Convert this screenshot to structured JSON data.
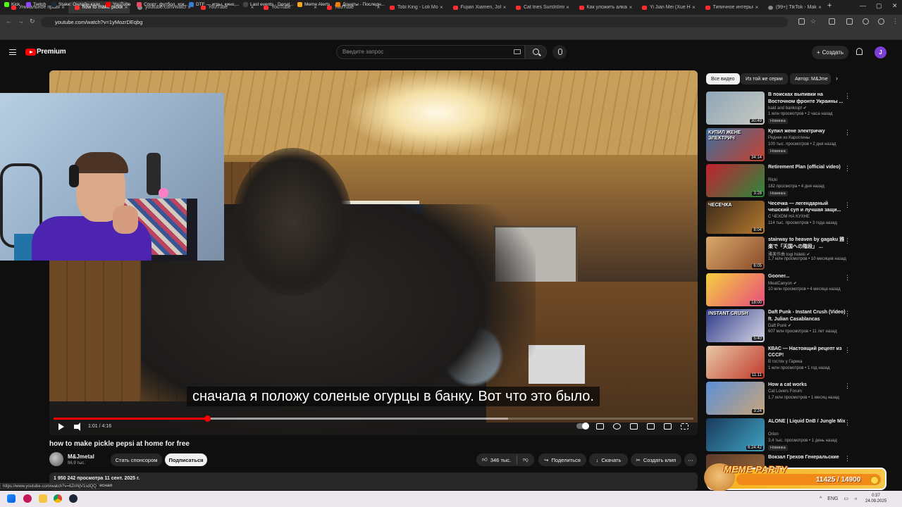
{
  "browser": {
    "tabs": [
      {
        "title": "Уникальное правил",
        "active": false,
        "favicon": "youtube-icon"
      },
      {
        "title": "how to make pickle",
        "active": true,
        "favicon": "youtube-icon"
      },
      {
        "title": "youtube.com/watch",
        "active": false,
        "favicon": "loading-icon"
      },
      {
        "title": "YouTube",
        "active": false,
        "favicon": "youtube-icon"
      },
      {
        "title": "YouTube",
        "active": false,
        "favicon": "youtube-icon"
      },
      {
        "title": "YouTube",
        "active": false,
        "favicon": "youtube-icon"
      },
      {
        "title": "Tobi King - Loli Mo",
        "active": false,
        "favicon": "youtube-icon"
      },
      {
        "title": "Fujian Xiamen, Joh",
        "active": false,
        "favicon": "youtube-icon"
      },
      {
        "title": "Cat tries Surströmm",
        "active": false,
        "favicon": "youtube-icon"
      },
      {
        "title": "Как уложить алкаш",
        "active": false,
        "favicon": "youtube-icon"
      },
      {
        "title": "Yi Jian Mei (Xue Hu",
        "active": false,
        "favicon": "youtube-icon"
      },
      {
        "title": "Типичное интерья",
        "active": false,
        "favicon": "youtube-icon"
      },
      {
        "title": "(99+) TikTok - Make",
        "active": false,
        "favicon": "tiktok-icon"
      }
    ],
    "new_tab": "+",
    "window_controls": [
      "—",
      "▢",
      "✕"
    ],
    "url": "youtube.com/watch?v=1yMozrDEqbg",
    "bookmarks": [
      {
        "label": "Kick",
        "color": "#53fc18"
      },
      {
        "label": "Twitch",
        "color": "#9146ff"
      },
      {
        "label": "Stake: Онлайн-кази...",
        "color": "#1a2c38"
      },
      {
        "label": "YouTube",
        "color": "#ff0000"
      },
      {
        "label": "Спорт: футбол, хок...",
        "color": "#e84a5f"
      },
      {
        "label": "DTF — игры, кино,...",
        "color": "#3a7bd5"
      },
      {
        "label": "Last events - Donat...",
        "color": "#444444"
      },
      {
        "label": "Meme Alerts",
        "color": "#f5a623"
      },
      {
        "label": "Донаты - Последн...",
        "color": "#f57c00"
      }
    ]
  },
  "header": {
    "brand": "Premium",
    "search_placeholder": "Введите запрос",
    "create_label": "Создать",
    "avatar_letter": "J"
  },
  "player": {
    "subtitle": "сначала я положу соленые огурцы в банку.  Вот что это было.",
    "time": "1:01 / 4:16",
    "progress_fraction": 0.24,
    "loaded_fraction": 0.71
  },
  "video": {
    "title": "how to make pickle pepsi at home for free",
    "channel": "M&Jmetal",
    "subscribers": "96,9 тыс.",
    "sponsor_label": "Стать спонсором",
    "subscribe_label": "Подписаться",
    "likes": "346 тыс.",
    "share_label": "Поделиться",
    "download_label": "Скачать",
    "clip_label": "Создать клип",
    "views_date": "1 950 242 просмотра  11 сент. 2025 г.",
    "desc_snippet": "весная"
  },
  "status_url": "https://www.youtube.com/watch?v=6ZnNjV1sdQQ",
  "sidebar": {
    "chips": [
      "Все видео",
      "Из той же серии",
      "Автор: M&Jme"
    ],
    "recommendations": [
      {
        "title": "В поисках выпивки на Восточном фронте Украины ...",
        "channel": "bald and bankrupt",
        "verified": true,
        "meta": "1 млн просмотров • 2 часа назад",
        "badge": "Новинка",
        "duration": "30:49",
        "thumb": [
          "#8fa6b8",
          "#c7c9c1"
        ]
      },
      {
        "title": "Купил жене электричку",
        "channel": "Реднек из Кароглины",
        "verified": false,
        "meta": "100 тыс. просмотров • 2 дня назад",
        "badge": "Новинка",
        "duration": "34:14",
        "thumb": [
          "#3d6e9e",
          "#c8412f"
        ],
        "thumb_text": "КУПИЛ ЖЕНЕ ЭЛЕКТРИЧ"
      },
      {
        "title": "Retirement Plan (official video)",
        "channel": "Ricki",
        "verified": false,
        "meta": "182 просмотра • 4 дня назад",
        "badge": "Новинка",
        "duration": "3:28",
        "thumb": [
          "#c32030",
          "#2b8a3e"
        ]
      },
      {
        "title": "Чесечка — легендарный чешский суп и лучшая защи...",
        "channel": "С ЧЕХОМ НА КУХНЕ",
        "verified": false,
        "meta": "114 тыс. просмотров • 3 года назад",
        "badge": "",
        "duration": "8:04",
        "thumb": [
          "#3a2a1a",
          "#b77a2f"
        ],
        "thumb_text": "ЧЕСЕЧКА"
      },
      {
        "title": "stairway to heaven by gagaku 雅楽で「天国への階段」 ...",
        "channel": "雅楽作曲 togi hideki",
        "verified": true,
        "meta": "1,7 млн просмотров • 10 месяцев назад",
        "badge": "",
        "duration": "6:05",
        "thumb": [
          "#d9a86a",
          "#8a4b2a"
        ]
      },
      {
        "title": "Gooner...",
        "channel": "MeatCanyon",
        "verified": true,
        "meta": "10 млн просмотров • 4 месяца назад",
        "badge": "",
        "duration": "18:00",
        "thumb": [
          "#f4d03f",
          "#e74c7c"
        ]
      },
      {
        "title": "Daft Punk - Instant Crush (Video) ft. Julian Casablancas",
        "channel": "Daft Punk",
        "verified": true,
        "meta": "607 млн просмотров • 11 лет назад",
        "badge": "",
        "duration": "5:40",
        "thumb": [
          "#2e3a86",
          "#d5d5e5"
        ],
        "thumb_text": "INSTANT CRUSH"
      },
      {
        "title": "КВАС — Настоящий рецепт из СССР!",
        "channel": "В гостях у Гарика",
        "verified": false,
        "meta": "1 млн просмотров • 1 год назад",
        "badge": "",
        "duration": "11:11",
        "thumb": [
          "#e8c9a8",
          "#c0392b"
        ]
      },
      {
        "title": "How a cat works",
        "channel": "Cat Lovers Forum",
        "verified": false,
        "meta": "1,7 млн просмотров • 1 месяц назад",
        "badge": "",
        "duration": "3:24",
        "thumb": [
          "#5b8fd6",
          "#c9a57a"
        ]
      },
      {
        "title": "ALONE | Liquid DnB / Jungle Mix",
        "channel": "Orion",
        "verified": false,
        "meta": "3,4 тыс. просмотров • 1 день назад",
        "badge": "Новинка",
        "duration": "6:24:42",
        "thumb": [
          "#1a3a5c",
          "#3fa2c2"
        ]
      },
      {
        "title": "Вокзал Грехов Генеральские",
        "channel": "",
        "verified": false,
        "meta": "",
        "badge": "",
        "duration": "",
        "thumb": [
          "#5a3a2a",
          "#9a6a3a"
        ]
      }
    ]
  },
  "meme_widget": {
    "title": "MEME PARTY",
    "count": "11425 / 14900"
  },
  "taskbar": {
    "lang": "ENG",
    "time": "0:37",
    "date": "24.09.2025"
  }
}
